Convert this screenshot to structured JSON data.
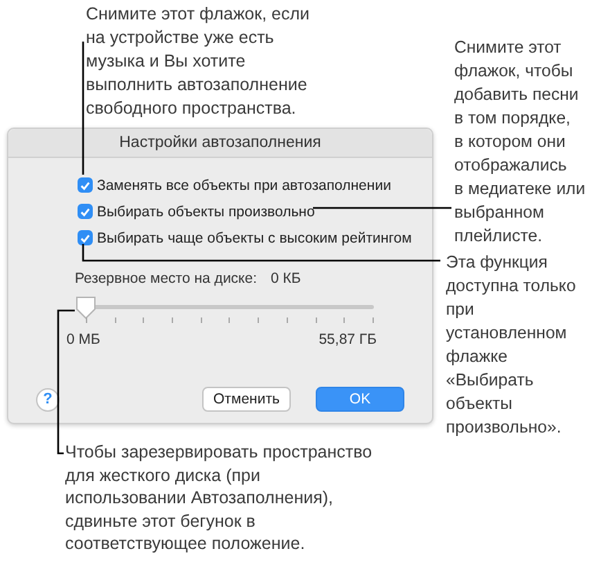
{
  "callouts": [
    {
      "text": "Снимите этот флажок, если\nна устройстве уже есть\nмузыка и Вы хотите\nвыполнить автозаполнение\nсвободного пространства."
    },
    {
      "text": "Снимите этот\nфлажок, чтобы\nдобавить песни\nв том порядке,\nв котором они\nотображались\nв медиатеке или\nвыбранном\nплейлисте."
    },
    {
      "text": "Эта функция\nдоступна только\nпри\nустановленном\nфлажке\n«Выбирать\nобъекты\nпроизвольно»."
    },
    {
      "text": "Чтобы зарезервировать пространство\nдля жесткого диска (при\nиспользовании Автозаполнения),\nсдвиньте этот бегунок в\nсоответствующее положение."
    }
  ],
  "dialog": {
    "title": "Настройки автозаполнения",
    "options": [
      {
        "label": "Заменять все объекты при автозаполнении",
        "checked": true
      },
      {
        "label": "Выбирать объекты произвольно",
        "checked": true
      },
      {
        "label": "Выбирать чаще объекты с высоким рейтингом",
        "checked": true
      }
    ],
    "reserve_label": "Резервное место на диске:",
    "reserve_value": "0 КБ",
    "slider": {
      "level": 0,
      "min_label": "0 МБ",
      "max_label": "55,87 ГБ"
    },
    "help": "?",
    "buttons": [
      {
        "label": "Отменить",
        "kind": "secondary"
      },
      {
        "label": "OK",
        "kind": "primary"
      }
    ]
  }
}
